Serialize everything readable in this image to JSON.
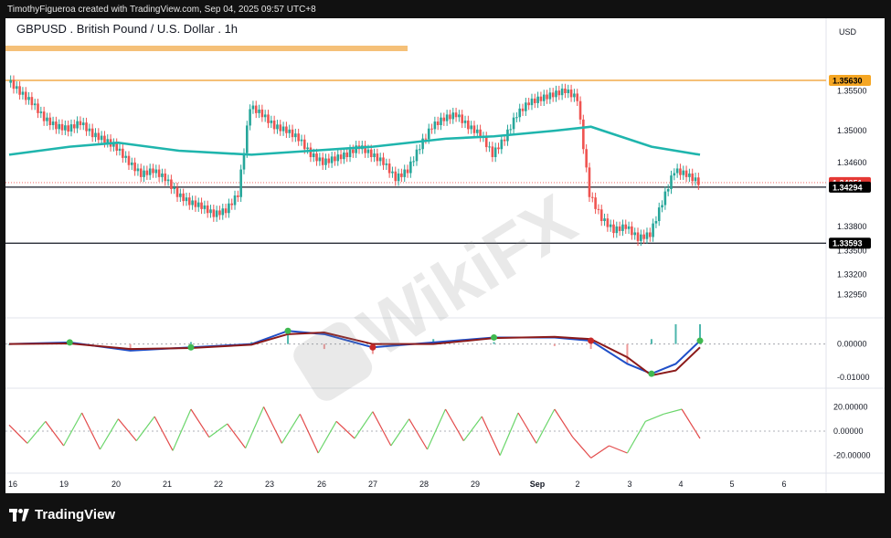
{
  "header": {
    "credit": "TimothyFigueroa created with TradingView.com, Sep 04, 2025 09:57 UTC+8"
  },
  "footer": {
    "brand": "TradingView"
  },
  "watermark": {
    "text": "WikiFX"
  },
  "colors": {
    "up": "#26a69a",
    "down": "#ef5350",
    "ema": "#1fb5ad",
    "resistance": "#f5c078",
    "macd": "#1f4fc8",
    "signal": "#8b1a1a",
    "rsi_up": "#6bd66b",
    "rsi_down": "#e34b4b"
  },
  "chart_data": {
    "type": "candlestick",
    "title": "GBPUSD . British Pound / U.S. Dollar . 1h",
    "currency": "USD",
    "x_ticks": [
      "16",
      "19",
      "20",
      "21",
      "22",
      "23",
      "26",
      "27",
      "28",
      "29",
      "Sep",
      "2",
      "3",
      "4",
      "5",
      "6"
    ],
    "price_ticks": [
      "1.35500",
      "1.35000",
      "1.34600",
      "1.33800",
      "1.33500",
      "1.33200",
      "1.32950"
    ],
    "price_range": [
      1.3275,
      1.3595
    ],
    "markers": [
      {
        "label": "1.35630",
        "value": 1.3563,
        "bg": "#f5a623",
        "fg": "#000"
      },
      {
        "label": "1.34351",
        "value": 1.34351,
        "bg": "#e53935",
        "fg": "#fff"
      },
      {
        "label": "1.34294",
        "value": 1.34294,
        "bg": "#000",
        "fg": "#fff"
      },
      {
        "label": "1.33593",
        "value": 1.33593,
        "bg": "#000",
        "fg": "#fff"
      }
    ],
    "horizontal_lines": [
      1.3563,
      1.34294,
      1.33593
    ],
    "close_path": [
      [
        0,
        1.3563
      ],
      [
        2,
        1.3548
      ],
      [
        4,
        1.3535
      ],
      [
        6,
        1.3515
      ],
      [
        8,
        1.3505
      ],
      [
        10,
        1.3502
      ],
      [
        12,
        1.351
      ],
      [
        14,
        1.3495
      ],
      [
        16,
        1.3488
      ],
      [
        18,
        1.3478
      ],
      [
        20,
        1.346
      ],
      [
        22,
        1.3445
      ],
      [
        24,
        1.345
      ],
      [
        26,
        1.344
      ],
      [
        28,
        1.342
      ],
      [
        30,
        1.341
      ],
      [
        32,
        1.3405
      ],
      [
        34,
        1.3395
      ],
      [
        36,
        1.34
      ],
      [
        38,
        1.342
      ],
      [
        40,
        1.353
      ],
      [
        42,
        1.352
      ],
      [
        44,
        1.3505
      ],
      [
        46,
        1.35
      ],
      [
        48,
        1.349
      ],
      [
        50,
        1.347
      ],
      [
        52,
        1.346
      ],
      [
        54,
        1.3465
      ],
      [
        56,
        1.347
      ],
      [
        58,
        1.348
      ],
      [
        60,
        1.347
      ],
      [
        62,
        1.346
      ],
      [
        64,
        1.344
      ],
      [
        66,
        1.345
      ],
      [
        68,
        1.348
      ],
      [
        70,
        1.3505
      ],
      [
        72,
        1.3515
      ],
      [
        74,
        1.352
      ],
      [
        76,
        1.3505
      ],
      [
        78,
        1.3495
      ],
      [
        80,
        1.347
      ],
      [
        82,
        1.349
      ],
      [
        84,
        1.352
      ],
      [
        86,
        1.3535
      ],
      [
        88,
        1.354
      ],
      [
        90,
        1.3545
      ],
      [
        92,
        1.355
      ],
      [
        94,
        1.354
      ],
      [
        96,
        1.342
      ],
      [
        98,
        1.339
      ],
      [
        100,
        1.3375
      ],
      [
        102,
        1.338
      ],
      [
        104,
        1.3365
      ],
      [
        106,
        1.337
      ],
      [
        108,
        1.341
      ],
      [
        110,
        1.345
      ],
      [
        112,
        1.3445
      ],
      [
        114,
        1.3435
      ]
    ],
    "ema_path": [
      [
        0,
        1.347
      ],
      [
        10,
        1.348
      ],
      [
        18,
        1.3485
      ],
      [
        28,
        1.3475
      ],
      [
        40,
        1.347
      ],
      [
        50,
        1.3475
      ],
      [
        60,
        1.348
      ],
      [
        72,
        1.349
      ],
      [
        80,
        1.3493
      ],
      [
        90,
        1.35
      ],
      [
        96,
        1.3505
      ],
      [
        100,
        1.3495
      ],
      [
        106,
        1.348
      ],
      [
        114,
        1.347
      ]
    ],
    "macd": {
      "ticks": [
        "0.00000",
        "-0.01000"
      ],
      "range": [
        -0.012,
        0.006
      ],
      "macd_path": [
        [
          0,
          0.0
        ],
        [
          10,
          0.0005
        ],
        [
          20,
          -0.002
        ],
        [
          30,
          -0.001
        ],
        [
          40,
          0.0
        ],
        [
          46,
          0.004
        ],
        [
          52,
          0.003
        ],
        [
          60,
          -0.001
        ],
        [
          70,
          0.0005
        ],
        [
          80,
          0.002
        ],
        [
          90,
          0.002
        ],
        [
          96,
          0.001
        ],
        [
          102,
          -0.006
        ],
        [
          106,
          -0.009
        ],
        [
          110,
          -0.006
        ],
        [
          114,
          0.001
        ]
      ],
      "signal_path": [
        [
          0,
          0.0
        ],
        [
          10,
          0.0002
        ],
        [
          20,
          -0.0015
        ],
        [
          30,
          -0.0012
        ],
        [
          40,
          -0.0002
        ],
        [
          46,
          0.003
        ],
        [
          52,
          0.0035
        ],
        [
          60,
          0.0
        ],
        [
          70,
          0.0
        ],
        [
          80,
          0.0018
        ],
        [
          90,
          0.0022
        ],
        [
          96,
          0.0015
        ],
        [
          102,
          -0.004
        ],
        [
          106,
          -0.0095
        ],
        [
          110,
          -0.008
        ],
        [
          114,
          -0.001
        ]
      ]
    },
    "rsi_osc": {
      "ticks": [
        "20.00000",
        "0.00000",
        "-20.00000"
      ],
      "range": [
        -30,
        30
      ],
      "path": [
        [
          0,
          5
        ],
        [
          3,
          -10
        ],
        [
          6,
          8
        ],
        [
          9,
          -12
        ],
        [
          12,
          15
        ],
        [
          15,
          -15
        ],
        [
          18,
          10
        ],
        [
          21,
          -8
        ],
        [
          24,
          12
        ],
        [
          27,
          -16
        ],
        [
          30,
          18
        ],
        [
          33,
          -5
        ],
        [
          36,
          6
        ],
        [
          39,
          -14
        ],
        [
          42,
          20
        ],
        [
          45,
          -10
        ],
        [
          48,
          14
        ],
        [
          51,
          -18
        ],
        [
          54,
          8
        ],
        [
          57,
          -6
        ],
        [
          60,
          16
        ],
        [
          63,
          -12
        ],
        [
          66,
          10
        ],
        [
          69,
          -15
        ],
        [
          72,
          18
        ],
        [
          75,
          -8
        ],
        [
          78,
          12
        ],
        [
          81,
          -20
        ],
        [
          84,
          15
        ],
        [
          87,
          -10
        ],
        [
          90,
          18
        ],
        [
          93,
          -5
        ],
        [
          96,
          -22
        ],
        [
          99,
          -12
        ],
        [
          102,
          -18
        ],
        [
          105,
          8
        ],
        [
          108,
          14
        ],
        [
          111,
          18
        ],
        [
          114,
          -6
        ]
      ]
    }
  }
}
